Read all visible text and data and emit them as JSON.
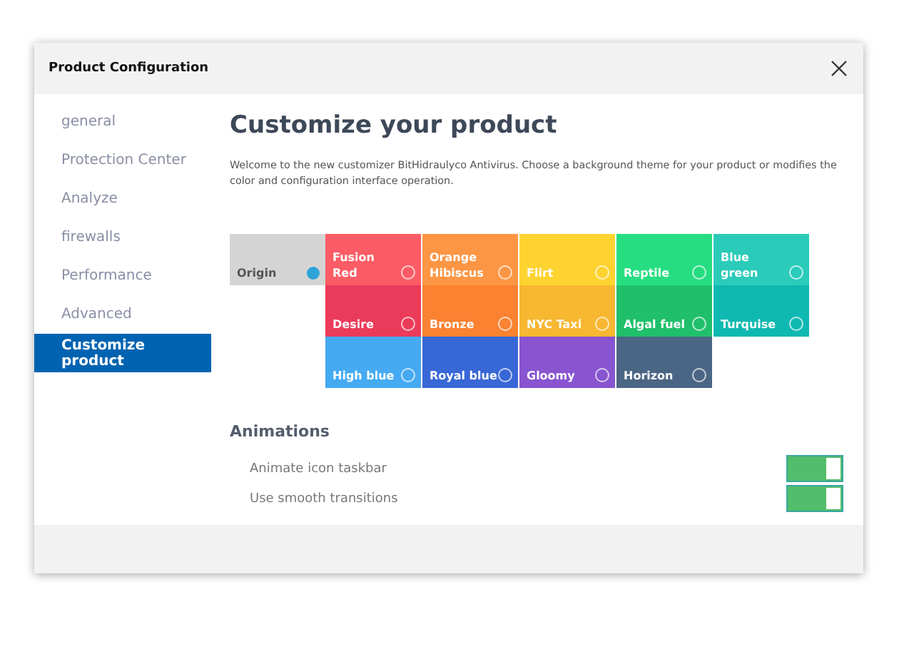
{
  "window": {
    "title": "Product Configuration"
  },
  "sidebar": {
    "items": [
      {
        "label": "general",
        "selected": false
      },
      {
        "label": "Protection Center",
        "selected": false
      },
      {
        "label": "Analyze",
        "selected": false
      },
      {
        "label": "firewalls",
        "selected": false
      },
      {
        "label": "Performance",
        "selected": false
      },
      {
        "label": "Advanced",
        "selected": false
      },
      {
        "label": "Customize product",
        "selected": true
      }
    ]
  },
  "content": {
    "title": "Customize your product",
    "description": "Welcome to the new customizer BitHidraulyco Antivirus. Choose a background theme for your product or modifies the color and configuration interface operation.",
    "default_theme": {
      "label": "Origin",
      "color": "#d4d4d4",
      "selected": true
    },
    "themes": [
      {
        "label": "Fusion Red",
        "color": "#fc5c65",
        "selected": false
      },
      {
        "label": "Orange Hibiscus",
        "color": "#fd9644",
        "selected": false
      },
      {
        "label": "Flirt",
        "color": "#fed330",
        "selected": false
      },
      {
        "label": "Reptile",
        "color": "#26de81",
        "selected": false
      },
      {
        "label": "Blue green",
        "color": "#2bcbba",
        "selected": false
      },
      {
        "label": "Desire",
        "color": "#eb3b5a",
        "selected": false
      },
      {
        "label": "Bronze",
        "color": "#fa8231",
        "selected": false
      },
      {
        "label": "NYC Taxi",
        "color": "#f7b731",
        "selected": false
      },
      {
        "label": "Algal fuel",
        "color": "#20bf6b",
        "selected": false
      },
      {
        "label": "Turquise",
        "color": "#0fb9b1",
        "selected": false
      },
      {
        "label": "High blue",
        "color": "#45aaf2",
        "selected": false
      },
      {
        "label": "Royal blue",
        "color": "#3867d6",
        "selected": false
      },
      {
        "label": "Gloomy",
        "color": "#8854d0",
        "selected": false
      },
      {
        "label": "Horizon",
        "color": "#4b6584",
        "selected": false
      }
    ],
    "animations": {
      "heading": "Animations",
      "options": [
        {
          "label": "Animate icon taskbar",
          "on": true
        },
        {
          "label": "Use smooth transitions",
          "on": true
        }
      ]
    }
  }
}
